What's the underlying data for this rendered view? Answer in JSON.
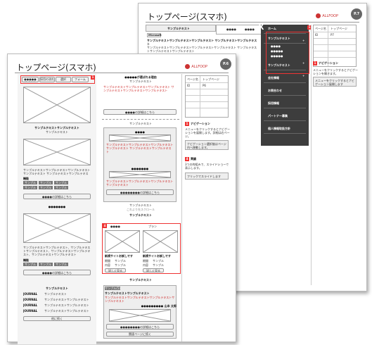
{
  "page7": {
    "title": "トップページ(スマホ)",
    "logo": "ALLFOOP",
    "page_number": "P.7",
    "section_title": "サンプルテキスト",
    "table_header": [
      "●●●●",
      "●●●●"
    ],
    "logo_tag": "Microsoft",
    "body_bold": "サンプルテキストサンプルテキストサンプルテキスト サンプルテキストサンプルテキスト",
    "body_text": "サンプルテキストサンプルテキストサンプルテキストサンプルテキスト サンプルテキストサンプルテキストサンプルテキスト",
    "menu_close": "X",
    "menu_items": [
      {
        "label": "ホーム",
        "sub": false
      },
      {
        "label": "サンプルテキスト",
        "sub": false
      },
      {
        "label": "●●●●",
        "sub": true
      },
      {
        "label": "●●●●●",
        "sub": true
      },
      {
        "label": "●●●●●",
        "sub": true
      },
      {
        "label": "サンプルテキスト",
        "sub": false
      },
      {
        "label": "会社情報",
        "sub": false
      },
      {
        "label": "お問合わせ",
        "sub": false
      },
      {
        "label": "採用情報",
        "sub": false
      },
      {
        "label": "パートナー募集",
        "sub": false
      },
      {
        "label": "個人情報取扱方針",
        "sub": false
      }
    ],
    "badge": "1",
    "spec_rows": [
      {
        "k": "ページ名",
        "v": "トップページ"
      },
      {
        "k": "ID",
        "v": "P7"
      },
      {
        "k": "",
        "v": ""
      },
      {
        "k": "",
        "v": ""
      },
      {
        "k": "",
        "v": ""
      },
      {
        "k": "",
        "v": ""
      }
    ],
    "note_title": "ナビゲーション",
    "note_text": "メニューをクリックするとナビゲーションを開きます。",
    "note_box": "メニューをクリックするとナビゲーション展開します"
  },
  "page6": {
    "title": "トップページ(スマホ)",
    "logo": "ALLFOOP",
    "page_number": "P.6",
    "nav_buttons": [
      "●●●●● 株式会社",
      "採用の流れ",
      "選択 ●●●●●",
      "フォーム ●●●●●"
    ],
    "badge1": "1",
    "left": {
      "heading1": "サンプルテキストサンプルテキスト",
      "sub1": "サンプルテキスト",
      "body": "サンプルテキストサンプルテキストサンプルテキストサンプルテキスト サンプルテキストサンプルテキストサンプルテキスト",
      "label1": "機能",
      "tags": [
        "サンプル",
        "サンプル",
        "サンプル",
        "サンプル",
        "サンプル",
        "サンプル"
      ],
      "link1": "●●●●の詳細はこちら",
      "heading2": "●●●●●●●",
      "body2": "サンプルテキストサンプルテキスト、サンプルテキストサンプルテキスト、サンプルテキストサンプルテキスト、サンプルテキストサンプルテキスト",
      "label2": "機能",
      "link2": "●●●●の詳細はこちら",
      "heading3": "サンプルテキスト",
      "rows": [
        {
          "k": "JOURNAL",
          "v": "サンプルテキスト"
        },
        {
          "k": "JOURNAL",
          "v": "サンプルテキストサンプルテキスト"
        },
        {
          "k": "JOURNAL",
          "v": "サンプルテキストサンプルテキスト"
        },
        {
          "k": "JOURNAL",
          "v": "サンプルテキストサンプルテキスト"
        }
      ],
      "more": "他に続く"
    },
    "mid": {
      "heading1": "●●●●●が選ばれる理由",
      "sub1": "サンプルテキスト",
      "body1": "サンプルテキストサンプルテキストサンプルテキスト サンプルテキストサンプルテキストサンプルテキスト",
      "link1": "●●●●の詳細はこちら",
      "mini_title": "サンプルテキスト",
      "heading2": "●●●●",
      "body2": "サンプルテキストサンプルテキストサンプルテキストサンプルテキスト サンプルテキストサンプルテキスト",
      "heading3": "●●●●●●●",
      "body3": "サンプルテキストサンプルテキストサンプルテキストサンプルテキスト",
      "link3": "●●●●●●●●の詳細はこちら",
      "caption": "サンプルテキスト",
      "cap2": "これより先スクロール",
      "heading4": "サンプルテキスト",
      "badge": "4",
      "card_tags": [
        "●●●●",
        "プラン"
      ],
      "card_titles": [
        "新規サイトお試しです",
        "新規サイトお試しです"
      ],
      "card_rows": [
        "期間",
        "サンプル",
        "内容",
        "サンプル"
      ],
      "card_btn": "詳しく見る",
      "heading5": "サンプルテキスト",
      "tag5": "サンプル(5)",
      "heading6": "サンプルテキストサンプルテキスト",
      "body6": "サンプルテキストサンプルテキストサンプルテキストサンプルテキスト",
      "name": "●●●●●●●●● 山本 太郎",
      "link6": "●●●●●●●●の詳細はこちら",
      "more": "関連ページに続く"
    },
    "spec_rows": [
      {
        "k": "ページ名",
        "v": "トップページ"
      },
      {
        "k": "ID",
        "v": "P6"
      },
      {
        "k": "",
        "v": ""
      },
      {
        "k": "",
        "v": ""
      },
      {
        "k": "",
        "v": ""
      },
      {
        "k": "",
        "v": ""
      }
    ],
    "note1_badge": "1",
    "note1_title": "ナビゲーション",
    "note1_text": "メニューをクリックするとナビゲーションを展開します。詳細は右ページ。",
    "note1_box": "ナビゲーション選択後はページ内へ移動します。",
    "note2_badge": "4",
    "note2_title": "実績",
    "note2_text": "3つの枠組みで、スライドショーで表示します。",
    "note2_box": "フリックでスライドします"
  },
  "colors": {
    "accent": "#e33333",
    "menu_bg": "#3d3d3d",
    "logo": "#cc3333"
  }
}
